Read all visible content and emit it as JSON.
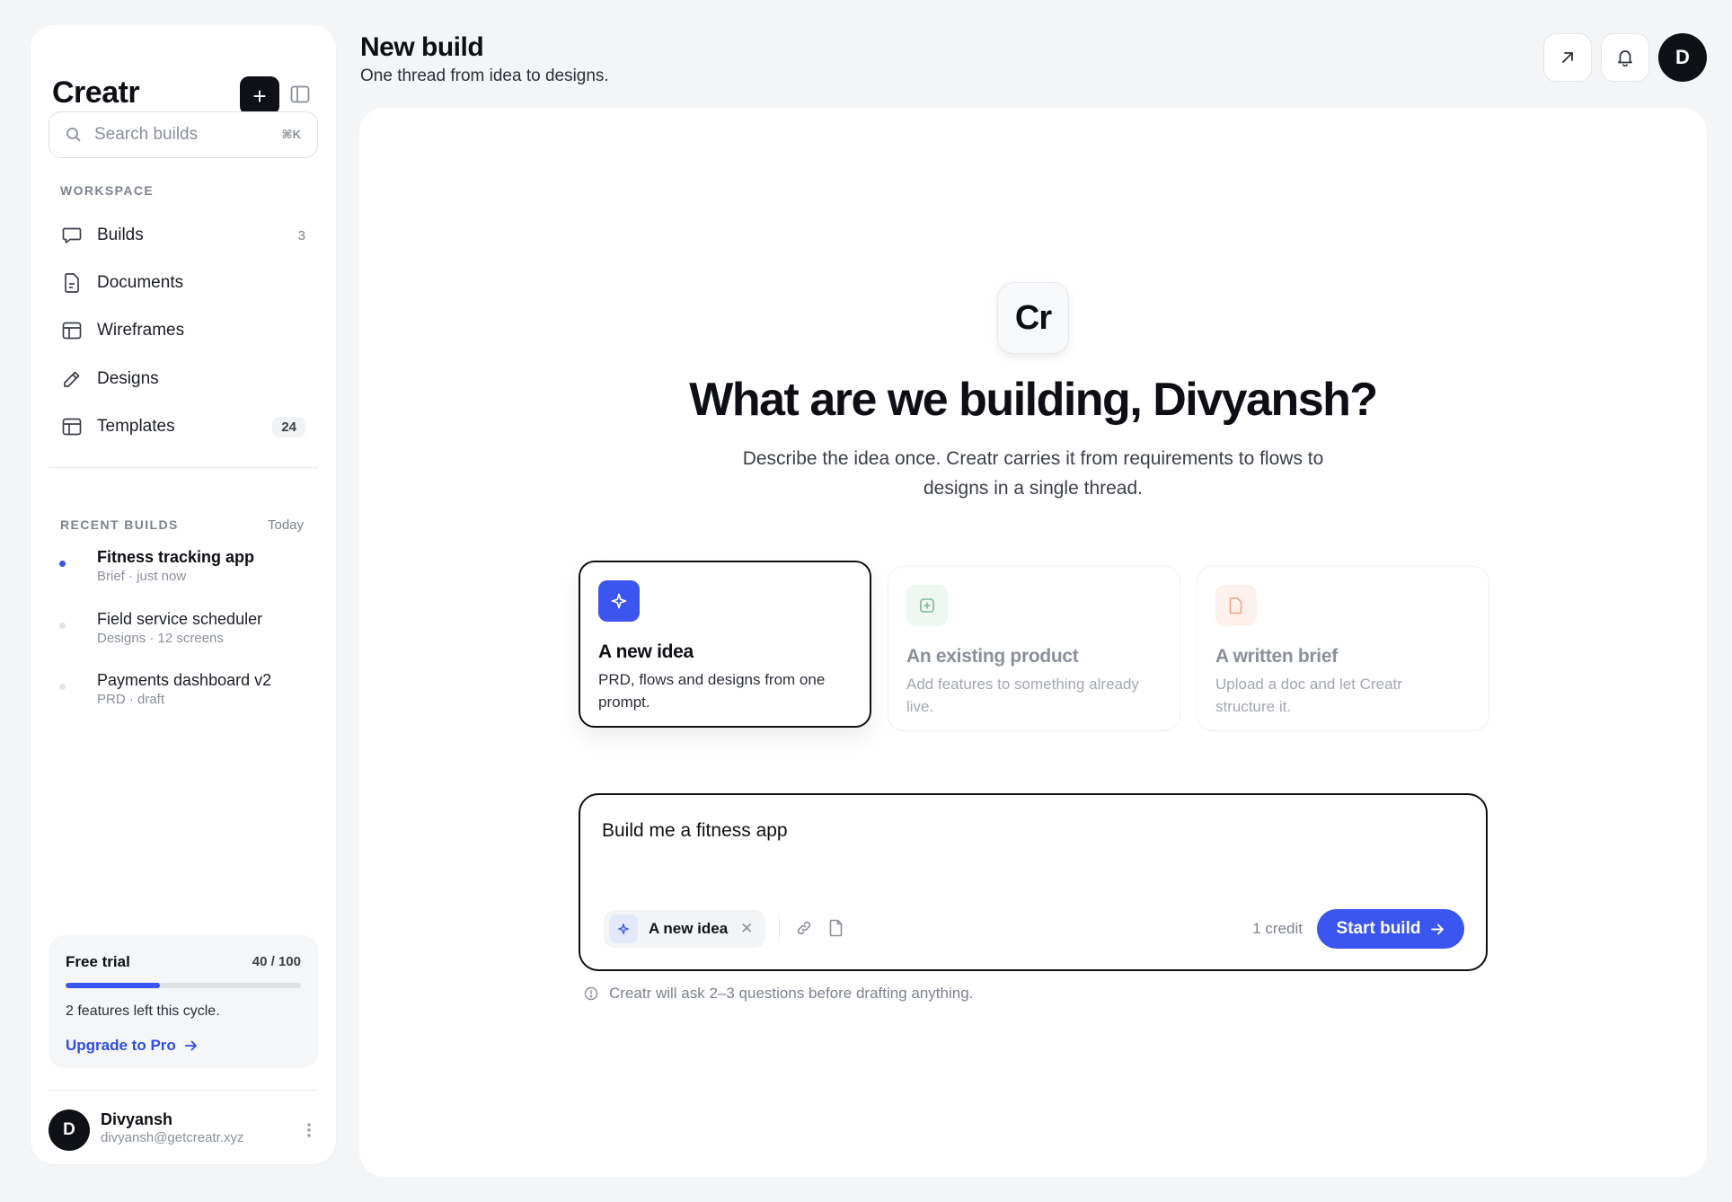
{
  "sidebar": {
    "brand": "Creatr",
    "search": {
      "placeholder": "Search builds",
      "shortcut": "⌘K"
    },
    "workspace_label": "WORKSPACE",
    "nav": [
      {
        "label": "Builds",
        "count": "3",
        "icon": "chat-bubble-icon"
      },
      {
        "label": "Documents",
        "count": "",
        "icon": "document-icon"
      },
      {
        "label": "Wireframes",
        "count": "",
        "icon": "layout-icon"
      },
      {
        "label": "Designs",
        "count": "",
        "icon": "pencil-icon"
      },
      {
        "label": "Templates",
        "count": "24",
        "icon": "template-icon"
      }
    ],
    "recent_label": "RECENT BUILDS",
    "recent_when": "Today",
    "recent": [
      {
        "title": "Fitness tracking app",
        "meta": "Brief · just now",
        "active": true
      },
      {
        "title": "Field service scheduler",
        "meta": "Designs · 12 screens",
        "active": false
      },
      {
        "title": "Payments dashboard v2",
        "meta": "PRD · draft",
        "active": false
      }
    ],
    "trial": {
      "label": "Free trial",
      "count": "40 / 100",
      "progress": 0.4,
      "note": "2 features left this cycle.",
      "upgrade": "Upgrade to Pro"
    },
    "user": {
      "initial": "D",
      "name": "Divyansh",
      "email": "divyansh@getcreatr.xyz"
    }
  },
  "header": {
    "title": "New build",
    "subtitle": "One thread from idea to designs.",
    "avatar_initial": "D"
  },
  "main": {
    "logo_text": "Cr",
    "hero": "What are we building, Divyansh?",
    "lede": "Describe the idea once. Creatr carries it from requirements to flows to designs in a single thread.",
    "options": [
      {
        "title": "A new idea",
        "desc": "PRD, flows and designs from one prompt.",
        "icon": "sparkle-icon",
        "selected": true
      },
      {
        "title": "An existing product",
        "desc": "Add features to something already live.",
        "icon": "plus-square-icon",
        "selected": false
      },
      {
        "title": "A written brief",
        "desc": "Upload a doc and let Creatr structure it.",
        "icon": "file-icon",
        "selected": false
      }
    ],
    "composer": {
      "value": "Build me a fitness app",
      "chip_label": "A new idea",
      "credit": "1 credit",
      "start_label": "Start build"
    },
    "hint": "Creatr will ask 2–3 questions before drafting anything."
  },
  "colors": {
    "accent": "#3b55f0",
    "ink": "#0d0f14",
    "muted": "#7d828c"
  }
}
